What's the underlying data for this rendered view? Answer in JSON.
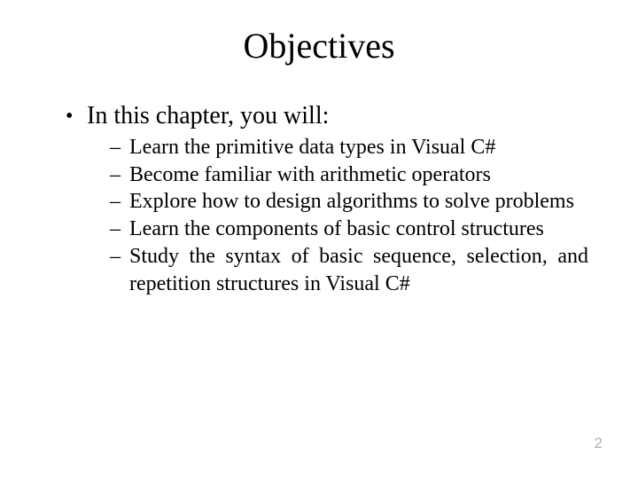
{
  "title": "Objectives",
  "intro": "In this chapter, you will:",
  "bullets": [
    "Learn the primitive data types in Visual C#",
    "Become familiar with arithmetic operators",
    "Explore how to design algorithms to solve problems",
    "Learn the components of basic control structures",
    "Study the syntax of basic sequence, selection, and repetition structures in Visual C#"
  ],
  "page_number": "2"
}
